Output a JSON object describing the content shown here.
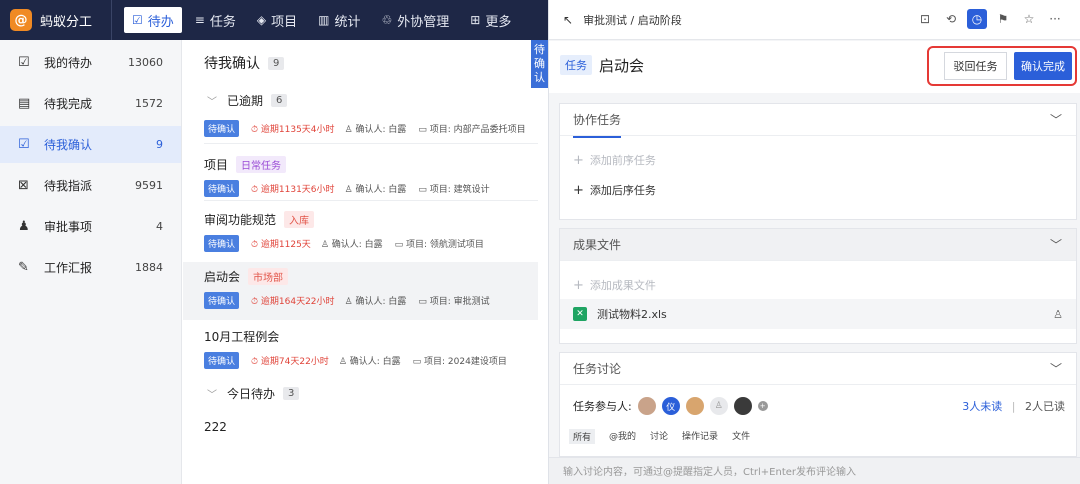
{
  "app": {
    "logo_char": "@",
    "name": "蚂蚁分工"
  },
  "topnav": [
    {
      "icon": "☑",
      "label": "待办",
      "active": true
    },
    {
      "icon": "≡",
      "label": "任务"
    },
    {
      "icon": "◈",
      "label": "项目"
    },
    {
      "icon": "▥",
      "label": "统计"
    },
    {
      "icon": "♲",
      "label": "外协管理"
    },
    {
      "icon": "⊞",
      "label": "更多"
    }
  ],
  "sidebar": [
    {
      "icon": "☑",
      "label": "我的待办",
      "count": "13060"
    },
    {
      "icon": "▤",
      "label": "待我完成",
      "count": "1572"
    },
    {
      "icon": "☑",
      "label": "待我确认",
      "count": "9",
      "active": true
    },
    {
      "icon": "⊠",
      "label": "待我指派",
      "count": "9591"
    },
    {
      "icon": "♟",
      "label": "审批事项",
      "count": "4"
    },
    {
      "icon": "✎",
      "label": "工作汇报",
      "count": "1884"
    }
  ],
  "list": {
    "title": "待我确认",
    "title_count": "9",
    "group_overdue": {
      "label": "已逾期",
      "count": "6"
    },
    "group_today": {
      "label": "今日待办",
      "count": "3"
    },
    "tasks": [
      {
        "name": "",
        "tag": "",
        "status": "待确认",
        "overdue": "逾期1135天4小时",
        "confirmer": "确认人: 白露",
        "project": "项目: 内部产品委托项目"
      },
      {
        "name": "项目",
        "tag": "日常任务",
        "tag_color": "purple",
        "status": "待确认",
        "overdue": "逾期1131天6小时",
        "confirmer": "确认人: 白露",
        "project": "项目: 建筑设计"
      },
      {
        "name": "审阅功能规范",
        "tag": "入库",
        "tag_color": "red",
        "status": "待确认",
        "overdue": "逾期1125天",
        "confirmer": "确认人: 白露",
        "project": "项目: 领航测试项目"
      },
      {
        "name": "启动会",
        "tag": "市场部",
        "tag_color": "red",
        "status": "待确认",
        "overdue": "逾期164天22小时",
        "confirmer": "确认人: 白露",
        "project": "项目: 审批测试"
      },
      {
        "name": "10月工程例会",
        "tag": "",
        "status": "待确认",
        "overdue": "逾期74天22小时",
        "confirmer": "确认人: 白露",
        "project": "项目: 2024建设项目"
      }
    ],
    "today_task": "222"
  },
  "vtab": [
    "待",
    "确",
    "认"
  ],
  "panel": {
    "breadcrumb": "审批测试 / 启动阶段",
    "type_tag": "任务",
    "title": "启动会",
    "reject_label": "驳回任务",
    "confirm_label": "确认完成",
    "collab": {
      "title": "协作任务",
      "add_pre": "添加前序任务",
      "add_post": "添加后序任务"
    },
    "files": {
      "title": "成果文件",
      "add": "添加成果文件",
      "file_name": "测试物料2.xls"
    },
    "discussion": {
      "title": "任务讨论",
      "participants_label": "任务参与人:",
      "avatar_initial": "仪",
      "unread": "3人未读",
      "sep": "|",
      "read": "2人已读",
      "filters": [
        "所有",
        "@我的",
        "讨论",
        "操作记录",
        "文件"
      ]
    },
    "input_placeholder": "输入讨论内容，可通过@提醒指定人员，Ctrl+Enter发布评论输入"
  }
}
